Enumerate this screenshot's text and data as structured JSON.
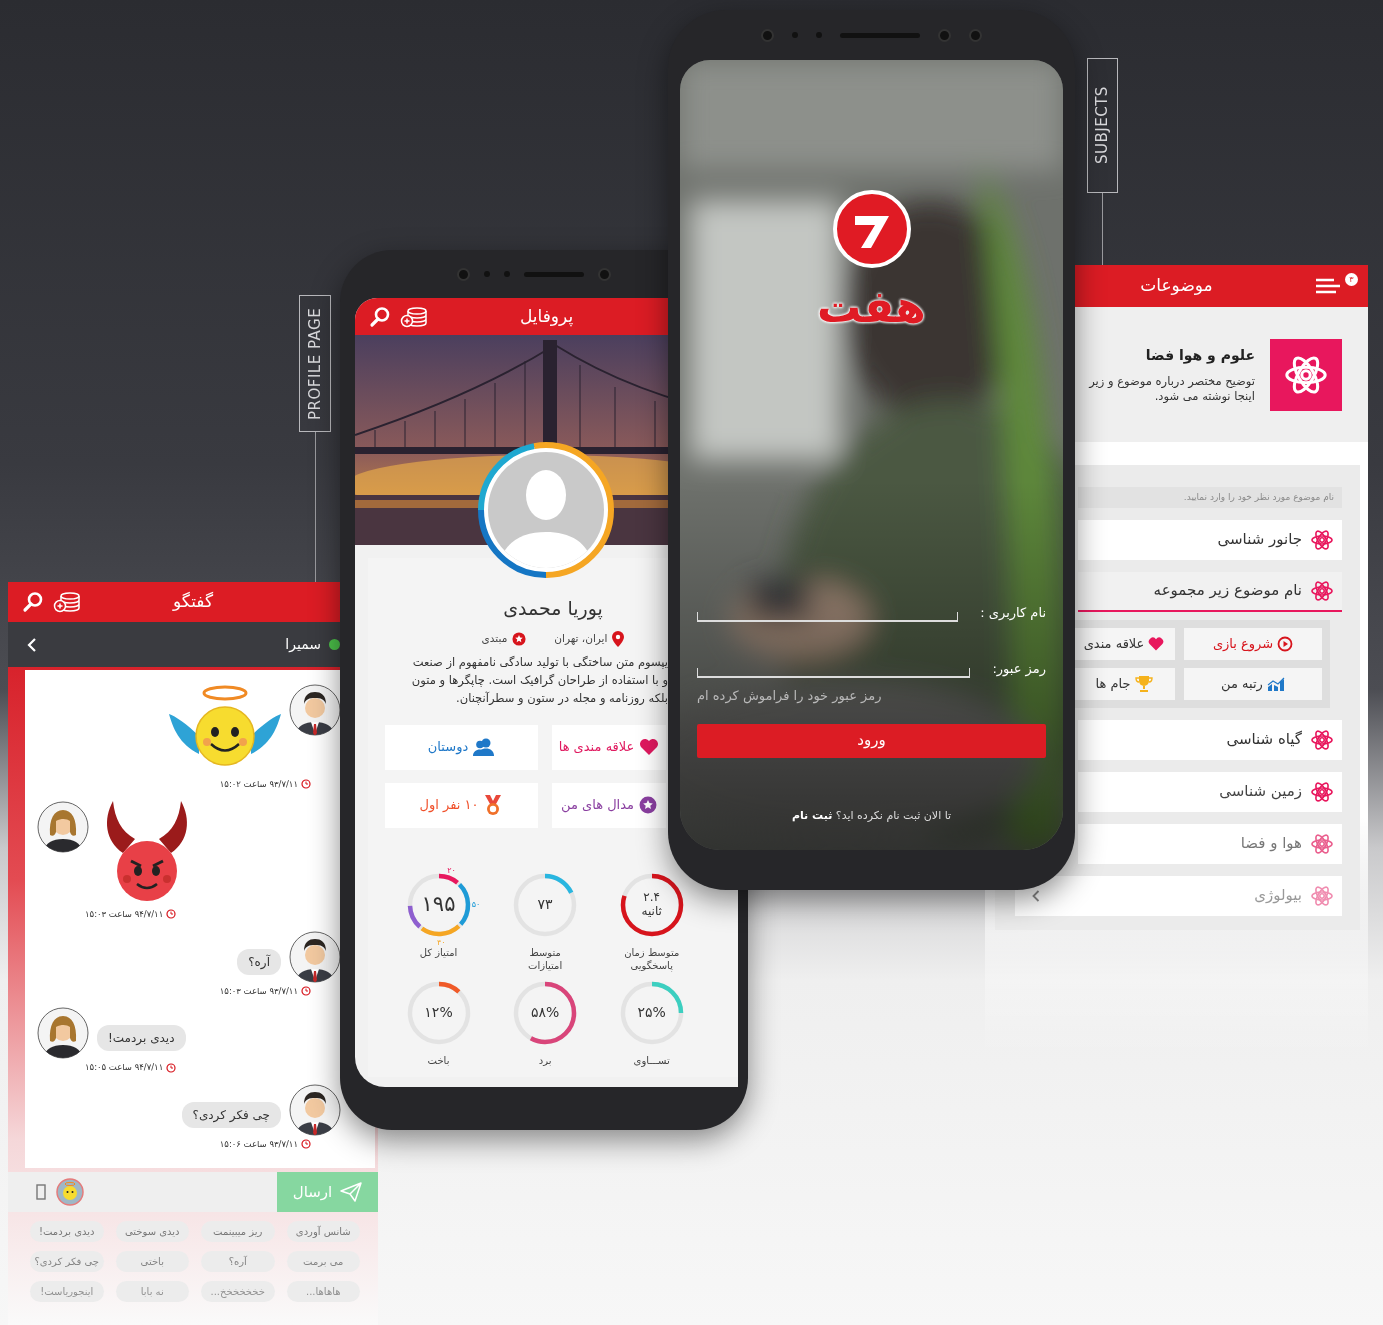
{
  "backdrop": {
    "labels": [
      {
        "text": "PROFILE PAGE"
      },
      {
        "text": "SUBJECTS"
      }
    ]
  },
  "chat_screen": {
    "title": "گفتگو",
    "contact": {
      "name": "سمیرا",
      "online": true
    },
    "messages": [
      {
        "outgoing": true,
        "kind": "angel_sticker",
        "time": "۹۳/۷/۱۱ ساعت ۱۵:۰۲"
      },
      {
        "outgoing": false,
        "kind": "devil_sticker",
        "time": "۹۴/۷/۱۱ ساعت ۱۵:۰۳"
      },
      {
        "outgoing": true,
        "kind": "text",
        "text": "آره؟",
        "time": "۹۳/۷/۱۱ ساعت ۱۵:۰۳"
      },
      {
        "outgoing": false,
        "kind": "text",
        "text": "دیدی بردمت!",
        "time": "۹۴/۷/۱۱ ساعت ۱۵:۰۵"
      },
      {
        "outgoing": true,
        "kind": "text",
        "text": "چی فکر کردی؟",
        "time": "۹۳/۷/۱۱ ساعت ۱۵:۰۶"
      }
    ],
    "send_button": "ارسال",
    "quick_replies": [
      "شانس آوردی",
      "ریز میبینمت",
      "دیدی سوختی",
      "دیدی بردمت!",
      "می برمت",
      "آره؟",
      "باختی",
      "چی فکر کردی؟",
      "هاهاها...",
      "خخخخخخخ...",
      "نه بابا",
      "اینجوریاست!"
    ]
  },
  "profile_screen": {
    "title": "پروفایل",
    "name": "پوریا محمدی",
    "location": "ایران، تهران",
    "level": "مبتدی",
    "bio": [
      "یپسوم متن ساختگی با تولید سادگی نامفهوم از صنعت",
      "و با استفاده از طراحان گرافیک است. چاپگرها و متون",
      "بلکه روزنامه و مجله در ستون و سطرآنچنان."
    ],
    "buttons": [
      {
        "label": "علاقه مندی ها",
        "color": "#e0195f"
      },
      {
        "label": "دوستان",
        "color": "#1f78c8"
      },
      {
        "label": "مدال های من",
        "color": "#8a3fa0"
      },
      {
        "label": "۱۰ نفر اول",
        "color": "#f0502a"
      }
    ],
    "stats": [
      {
        "kind": "single",
        "value": "۲.۴",
        "unit": "ثانیه",
        "label": "متوسط زمان\nپاسخگویی",
        "level": 0.8,
        "color": "#d7141c"
      },
      {
        "kind": "single",
        "value": "۷۳",
        "label": "متوسط\nامتیازات",
        "level": 0.18,
        "color": "#29b6e0"
      },
      {
        "kind": "segmented",
        "value": "۱۹۵",
        "label": "امتیاز کل",
        "segments": [
          {
            "label": "۲۰",
            "color": "#e8175d"
          },
          {
            "label": "۵۰",
            "color": "#1e9bd7"
          },
          {
            "label": "۴۰",
            "color": "#f5a623"
          },
          {
            "color": "#8e5fcf"
          }
        ]
      },
      {
        "kind": "single",
        "value": "۲۵%",
        "label": "تســـاوی",
        "level": 0.25,
        "color": "#3ccfc0"
      },
      {
        "kind": "single",
        "value": "۵۸%",
        "label": "برد",
        "level": 0.58,
        "color": "#d9457a"
      },
      {
        "kind": "single",
        "value": "۱۲%",
        "label": "باخت",
        "level": 0.12,
        "color": "#f05a28"
      }
    ]
  },
  "login_screen": {
    "brand": "هفت",
    "fields": [
      {
        "label": "نام کاربری :"
      },
      {
        "label": "رمز عبور:"
      }
    ],
    "forgot_link": "رمز عبور خود را فراموش کرده ام",
    "submit_button": "ورود",
    "signup_prompt": "تا الان ثبت نام نکرده اید؟ **ثبت نام**"
  },
  "subjects_screen": {
    "title": "موضوعات",
    "menu_badge": "۳",
    "category": {
      "title": "علوم و هوا فضا",
      "description": [
        "توضیح مختصر درباره موضوع و زیر",
        "اینجا نوشته می شود."
      ]
    },
    "search": {
      "placeholder": "نام موضوع مورد نظر خود را وارد نمایید."
    },
    "items": [
      {
        "label": "جانور شناسی",
        "expanded": false
      },
      {
        "label": "نام موضوع زیر مجموعه",
        "expanded": true,
        "actions": [
          {
            "label": "شروع بازی",
            "color": "#d7141c"
          },
          {
            "label": "علاقه مندی",
            "color": "#333333"
          },
          {
            "label": "رتبه من",
            "color": "#333333"
          },
          {
            "label": "جام ها",
            "color": "#333333"
          }
        ]
      },
      {
        "label": "گیاه شناسی",
        "expanded": false
      },
      {
        "label": "زمین شناسی",
        "expanded": false
      },
      {
        "label": "هوا و فضا",
        "expanded": false
      },
      {
        "label": "بیولوژی",
        "expanded": false
      }
    ]
  }
}
